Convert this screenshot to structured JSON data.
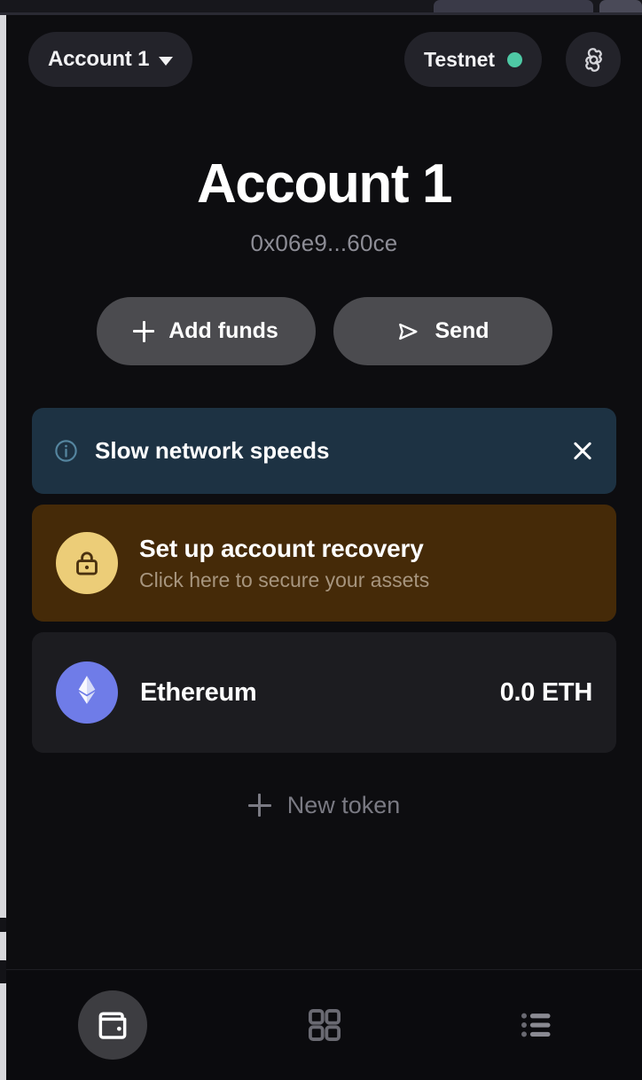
{
  "browser": {
    "chrome_visible": true
  },
  "topbar": {
    "account_switcher_label": "Account 1",
    "account_switcher_icon": "chevron-down-icon",
    "network_label": "Testnet",
    "network_status_color": "#4ec9a5",
    "settings_icon": "gear-icon"
  },
  "account": {
    "name": "Account 1",
    "address": "0x06e9...60ce"
  },
  "actions": [
    {
      "label": "Add funds",
      "icon": "plus-icon"
    },
    {
      "label": "Send",
      "icon": "send-icon"
    }
  ],
  "alert": {
    "icon": "info-circle-icon",
    "text": "Slow network speeds",
    "close_icon": "close-icon",
    "background": "#1d3243"
  },
  "recovery": {
    "icon": "lock-icon",
    "title": "Set up account recovery",
    "subtitle": "Click here to secure your assets",
    "background": "#452a08",
    "icon_background": "#eccd78"
  },
  "tokens": [
    {
      "icon": "ethereum-icon",
      "name": "Ethereum",
      "balance": "0.0 ETH",
      "icon_background": "#6f7ce8"
    }
  ],
  "new_token": {
    "label": "New token",
    "icon": "plus-icon"
  },
  "bottom_nav": [
    {
      "icon": "wallet-icon",
      "active": true
    },
    {
      "icon": "grid-apps-icon",
      "active": false
    },
    {
      "icon": "list-icon",
      "active": false
    }
  ]
}
